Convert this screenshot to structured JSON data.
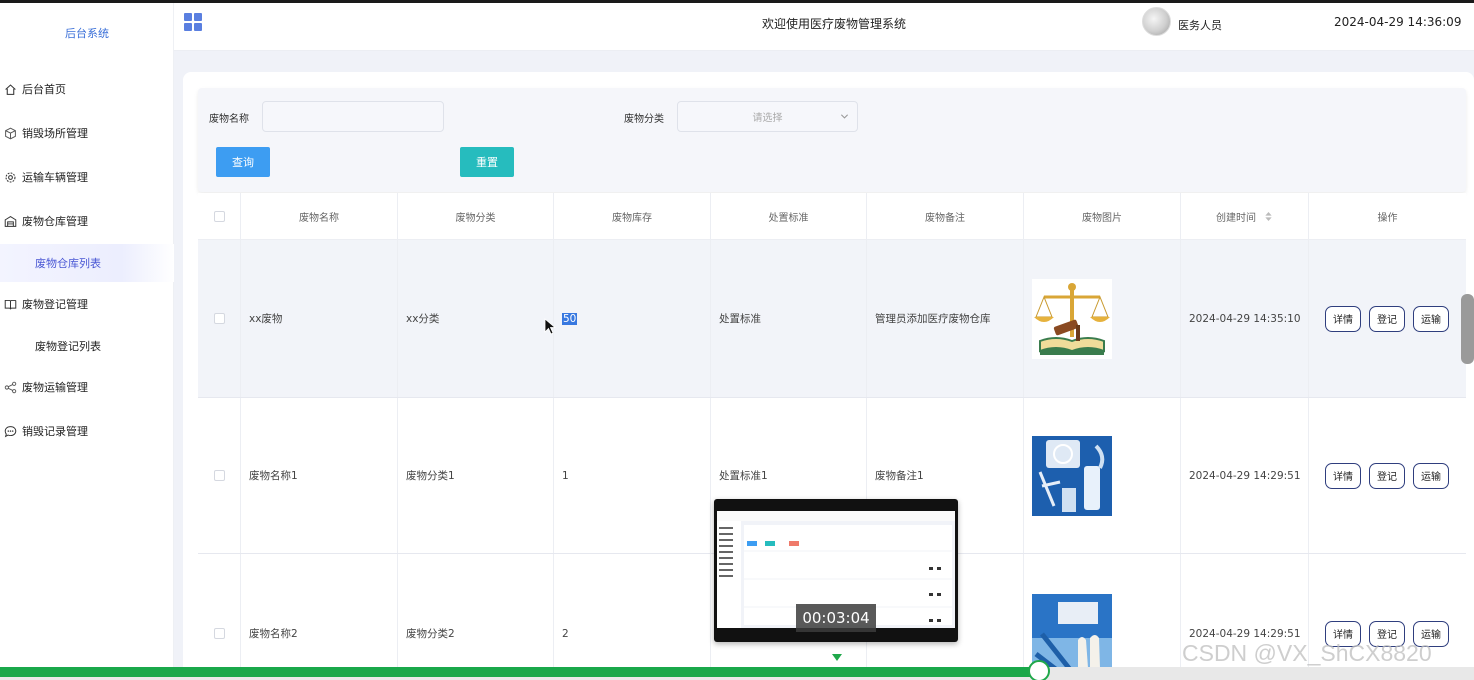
{
  "sidebar": {
    "brand": "后台系统",
    "menu": [
      {
        "label": "后台首页",
        "icon": "home-icon"
      },
      {
        "label": "销毁场所管理",
        "icon": "cube-icon"
      },
      {
        "label": "运输车辆管理",
        "icon": "gear-icon"
      },
      {
        "label": "废物仓库管理",
        "icon": "warehouse-icon"
      },
      {
        "label": "废物登记管理",
        "icon": "book-icon"
      },
      {
        "label": "废物运输管理",
        "icon": "share-icon"
      },
      {
        "label": "销毁记录管理",
        "icon": "chat-icon"
      }
    ],
    "submenu": {
      "warehouse_list": "废物仓库列表",
      "register_list": "废物登记列表"
    }
  },
  "header": {
    "title": "欢迎使用医疗废物管理系统",
    "user": "医务人员",
    "datetime": "2024-04-29 14:36:09"
  },
  "search": {
    "name_label": "废物名称",
    "name_placeholder": "",
    "category_label": "废物分类",
    "category_placeholder": "请选择",
    "query_button": "查询",
    "reset_button": "重置"
  },
  "table": {
    "columns": [
      "废物名称",
      "废物分类",
      "废物库存",
      "处置标准",
      "废物备注",
      "废物图片",
      "创建时间",
      "操作"
    ],
    "rows": [
      {
        "name": "xx废物",
        "category": "xx分类",
        "stock": "50",
        "standard": "处置标准",
        "remark": "管理员添加医疗废物仓库",
        "image": "scales-justice-image",
        "created": "2024-04-29 14:35:10"
      },
      {
        "name": "废物名称1",
        "category": "废物分类1",
        "stock": "1",
        "standard": "处置标准1",
        "remark": "废物备注1",
        "image": "medical-supplies-image",
        "created": "2024-04-29 14:29:51"
      },
      {
        "name": "废物名称2",
        "category": "废物分类2",
        "stock": "2",
        "standard": "",
        "remark": "",
        "image": "gloves-image",
        "created": "2024-04-29 14:29:51"
      }
    ],
    "actions": {
      "detail": "详情",
      "register": "登记",
      "transport": "运输"
    }
  },
  "video": {
    "timecode": "00:03:04",
    "progress": 0.705
  },
  "watermark": "CSDN @VX_ShCX8820",
  "colors": {
    "accent": "#3d9df2",
    "reset": "#26bcbe",
    "sidebar_active": "#4957d4",
    "progress": "#19a84a"
  }
}
